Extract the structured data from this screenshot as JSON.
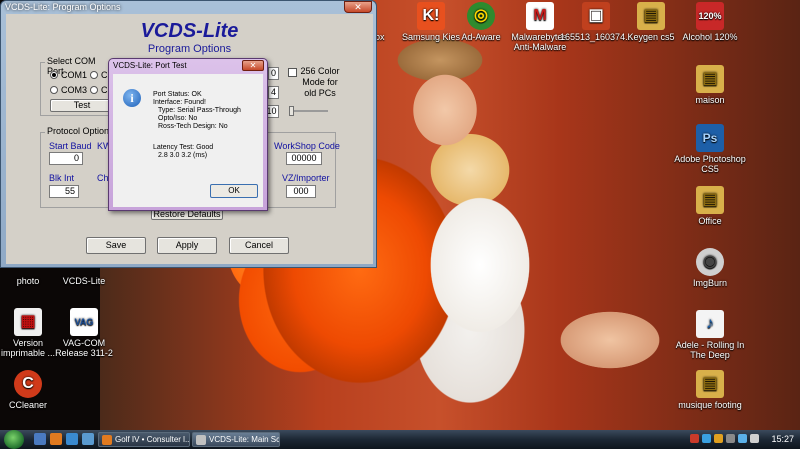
{
  "desktop": {
    "top_icons": [
      {
        "label": "efox"
      },
      {
        "label": "Samsung Kies",
        "glyph": "K!",
        "color": "#e8501e"
      },
      {
        "label": "Ad-Aware",
        "glyph": "◎",
        "color": "#2e8b2e"
      },
      {
        "label": "Malwarebytes' Anti-Malware",
        "glyph": "M",
        "color": "#c91b1b"
      },
      {
        "label": "165513_160374...",
        "glyph": "▣",
        "color": "#c0401e"
      },
      {
        "label": "Keygen cs5",
        "glyph": "▤",
        "color": "#d8b04a"
      },
      {
        "label": "Alcohol 120%",
        "glyph": "120%",
        "color": "#c82828"
      }
    ],
    "right_icons": [
      {
        "label": "maison",
        "glyph": "▤",
        "color": "#d8b04a"
      },
      {
        "label": "Adobe Photoshop CS5",
        "glyph": "Ps",
        "color": "#1d5fa8"
      },
      {
        "label": "Office",
        "glyph": "▤",
        "color": "#d8b04a"
      },
      {
        "label": "ImgBurn",
        "glyph": "◉",
        "color": "#aaaaaa"
      },
      {
        "label": "Adele - Rolling In The Deep",
        "glyph": "♪",
        "color": "#e8e8e8"
      },
      {
        "label": "musique footing",
        "glyph": "▤",
        "color": "#d8b04a"
      }
    ],
    "left_icons": [
      {
        "label": "photo"
      },
      {
        "label": "VCDS-Lite"
      },
      {
        "label": "Version imprimable ...",
        "glyph": "▦",
        "color": "#f0f0f0"
      },
      {
        "label": "VAG-COM Release 311-2",
        "glyph": "VAG",
        "color": "#1a4f9a"
      },
      {
        "label": "CCleaner",
        "glyph": "C",
        "color": "#d03a1a"
      }
    ]
  },
  "main_window": {
    "title": "VCDS-Lite: Program Options",
    "close_glyph": "✕",
    "app_title": "VCDS-Lite",
    "app_subtitle": "Program Options",
    "com_group": {
      "legend": "Select COM Port",
      "ports": [
        {
          "label": "COM1",
          "selected": true
        },
        {
          "label": "CO",
          "selected": false
        },
        {
          "label": "COM3",
          "selected": false
        },
        {
          "label": "C",
          "selected": false
        }
      ],
      "test_label": "Test"
    },
    "right_side": {
      "field_a": "0",
      "field_b": "4",
      "field_c": "10",
      "color_mode_label_1": "256 Color",
      "color_mode_label_2": "Mode for",
      "color_mode_label_3": "old PCs"
    },
    "protocol_group": {
      "legend": "Protocol Options",
      "start_baud_label": "Start Baud",
      "start_baud_value": "0",
      "kw_label": "KW",
      "blk_int_label": "Blk Int",
      "blk_int_value": "55",
      "cha_label": "Cha",
      "workshop_label": "WorkShop Code",
      "workshop_value": "00000",
      "vz_label": "VZ/Importer",
      "vz_value": "000",
      "restore_label": "Restore Defaults"
    },
    "buttons": {
      "save": "Save",
      "apply": "Apply",
      "cancel": "Cancel"
    }
  },
  "port_test": {
    "title": "VCDS-Lite: Port Test",
    "close_glyph": "✕",
    "icon_glyph": "i",
    "lines": [
      "Port Status: OK",
      "Interface: Found!",
      "  Type: Serial Pass-Through",
      "  Opto/Iso: No",
      "  Ross-Tech Design: No",
      "",
      "Latency Test: Good",
      "  2.8  3.0  3.2 (ms)"
    ],
    "ok_label": "OK"
  },
  "taskbar": {
    "tasks": [
      {
        "label": "Golf IV • Consulter l...",
        "active": false
      },
      {
        "label": "VCDS-Lite: Main Scr...",
        "active": true
      }
    ],
    "clock": "15:27"
  },
  "colors": {
    "accent_blue": "#1a1a9a",
    "dialog_purple": "#c7a3da"
  }
}
